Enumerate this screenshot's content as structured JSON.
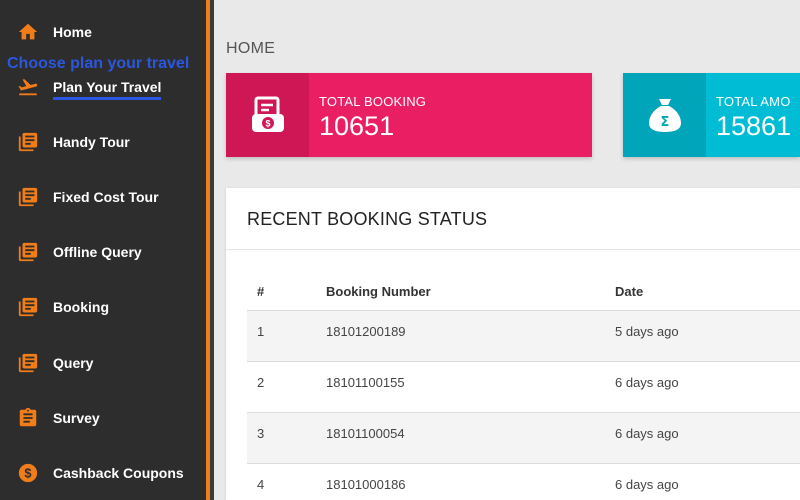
{
  "sidebar": {
    "items": [
      {
        "label": "Home",
        "icon": "home-icon"
      },
      {
        "label": "Plan Your Travel",
        "icon": "flight-takeoff-icon"
      },
      {
        "label": "Handy Tour",
        "icon": "document-stack-icon"
      },
      {
        "label": "Fixed Cost Tour",
        "icon": "document-stack-icon"
      },
      {
        "label": "Offline Query",
        "icon": "document-stack-icon"
      },
      {
        "label": "Booking",
        "icon": "document-stack-icon"
      },
      {
        "label": "Query",
        "icon": "document-stack-icon"
      },
      {
        "label": "Survey",
        "icon": "clipboard-icon"
      },
      {
        "label": "Cashback Coupons",
        "icon": "dollar-circle-icon"
      }
    ],
    "tooltip": "Choose plan your travel"
  },
  "breadcrumb": "HOME",
  "cards": [
    {
      "title": "TOTAL BOOKING",
      "value": "10651",
      "color": "#e91e63",
      "icon_bg": "#cf1756",
      "icon": "receipt-coin-icon"
    },
    {
      "title": "TOTAL AMO",
      "value": "15861",
      "color": "#00bcd4",
      "icon_bg": "#00a5ba",
      "icon": "money-bag-icon"
    }
  ],
  "recent": {
    "title": "RECENT BOOKING STATUS",
    "headers": [
      "#",
      "Booking Number",
      "Date"
    ],
    "rows": [
      {
        "num": "1",
        "booking": "18101200189",
        "date": "5 days ago"
      },
      {
        "num": "2",
        "booking": "18101100155",
        "date": "6 days ago"
      },
      {
        "num": "3",
        "booking": "18101100054",
        "date": "6 days ago"
      },
      {
        "num": "4",
        "booking": "18101000186",
        "date": "6 days ago"
      }
    ]
  },
  "colors": {
    "sidebar_bg": "#2d2d2d",
    "accent_orange": "#f07d1a",
    "active_blue": "#2b56e0"
  }
}
